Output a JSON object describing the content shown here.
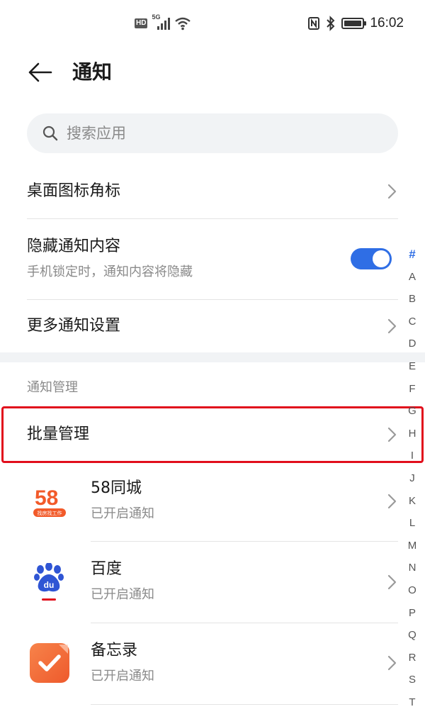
{
  "status_bar": {
    "hd_label": "HD",
    "network_label": "5G",
    "time": "16:02",
    "icons": [
      "hd-icon",
      "signal-icon",
      "wifi-icon",
      "nfc-icon",
      "bluetooth-icon",
      "battery-icon"
    ]
  },
  "header": {
    "back_icon": "arrow-left-icon",
    "title": "通知"
  },
  "search": {
    "icon": "search-icon",
    "placeholder": "搜索应用"
  },
  "settings": {
    "badge": {
      "title": "桌面图标角标"
    },
    "hide_content": {
      "title": "隐藏通知内容",
      "subtitle": "手机锁定时，通知内容将隐藏",
      "enabled": true
    },
    "more": {
      "title": "更多通知设置"
    }
  },
  "section": {
    "label": "通知管理"
  },
  "batch": {
    "title": "批量管理"
  },
  "apps": [
    {
      "name": "58同城",
      "status": "已开启通知",
      "icon": "58-app-icon",
      "icon_label": "58",
      "icon_caption": "找房找工作"
    },
    {
      "name": "百度",
      "status": "已开启通知",
      "icon": "baidu-paw-icon",
      "icon_label": "du"
    },
    {
      "name": "备忘录",
      "status": "已开启通知",
      "icon": "notes-check-icon"
    }
  ],
  "alpha_index": [
    "#",
    "A",
    "B",
    "C",
    "D",
    "E",
    "F",
    "G",
    "H",
    "I",
    "J",
    "K",
    "L",
    "M",
    "N",
    "O",
    "P",
    "Q",
    "R",
    "S",
    "T"
  ],
  "colors": {
    "accent": "#2f6ee5",
    "highlight": "#e10e1c",
    "secondary_text": "#8a8a8a",
    "search_bg": "#f1f3f5"
  }
}
